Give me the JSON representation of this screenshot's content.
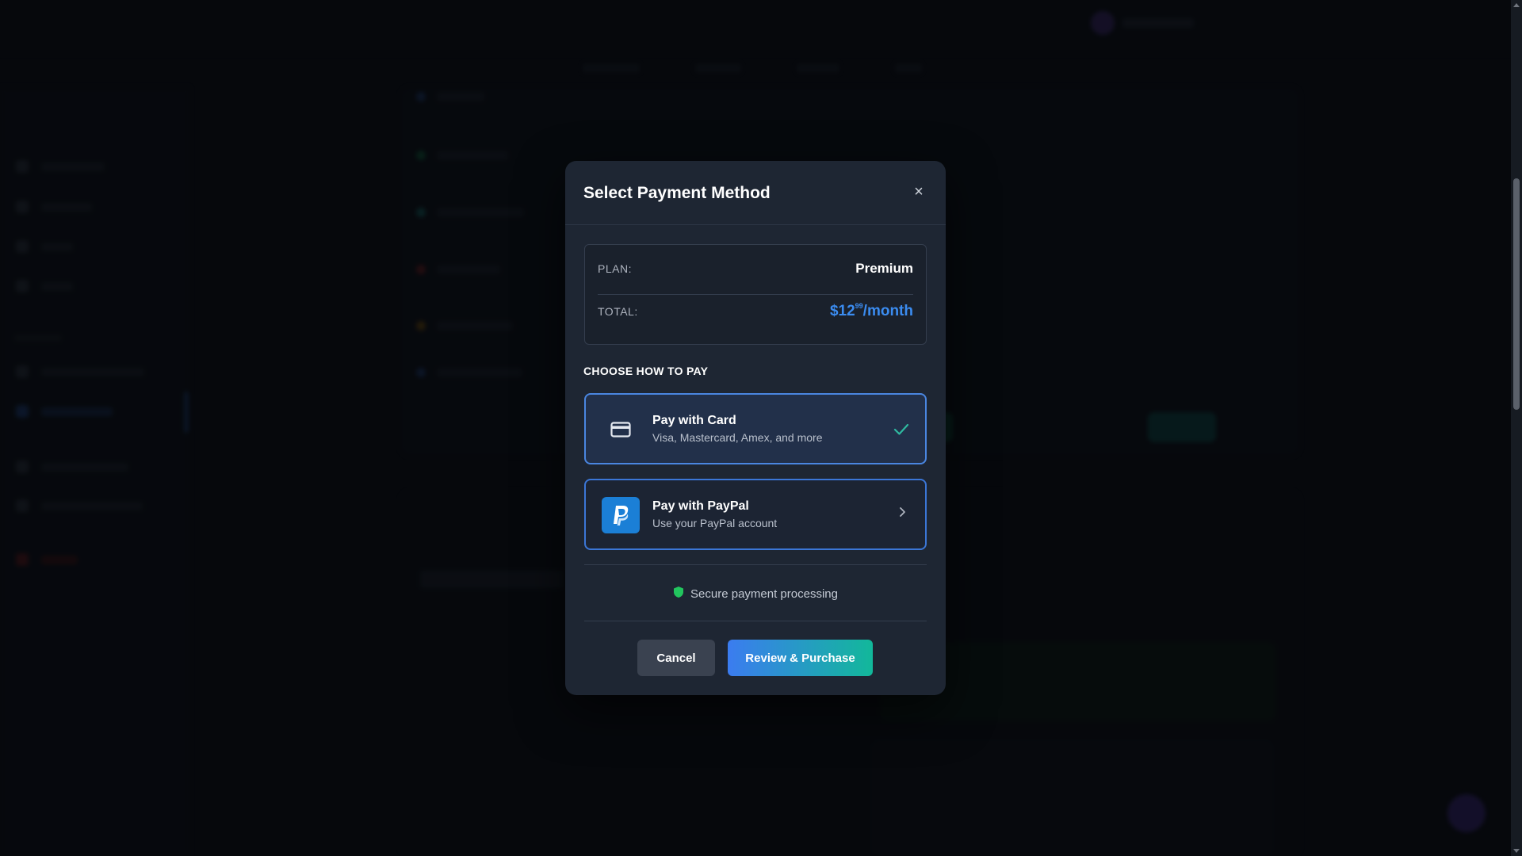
{
  "modal": {
    "title": "Select Payment Method",
    "close_label": "×",
    "summary": {
      "plan_label": "PLAN:",
      "plan_value": "Premium",
      "total_label": "TOTAL:",
      "total_main": "$12",
      "total_cents": "99",
      "total_period": "/month"
    },
    "choose_label": "CHOOSE HOW TO PAY",
    "options": [
      {
        "title": "Pay with Card",
        "subtitle": "Visa, Mastercard, Amex, and more",
        "icon": "credit-card-icon",
        "selected": true
      },
      {
        "title": "Pay with PayPal",
        "subtitle": "Use your PayPal account",
        "icon": "paypal-icon",
        "selected": false
      }
    ],
    "secure_text": "Secure payment processing",
    "cancel_label": "Cancel",
    "purchase_label": "Review & Purchase"
  },
  "colors": {
    "accent_blue": "#3b8cf0",
    "accent_teal": "#12b89a",
    "modal_bg": "#1e2633",
    "secure_green": "#22c55e"
  }
}
